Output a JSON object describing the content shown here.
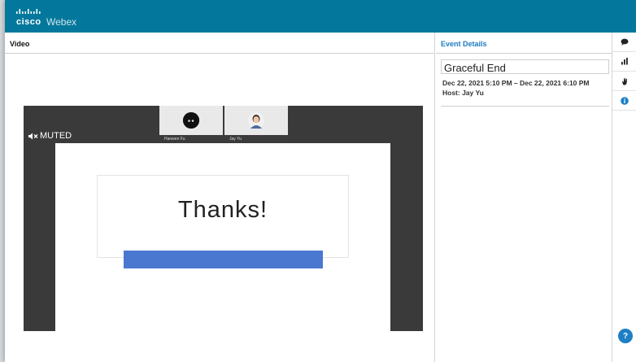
{
  "app": {
    "brand": "cisco",
    "product": "Webex",
    "brand_color": "#04789c"
  },
  "video_panel": {
    "title": "Video",
    "muted_label": "MUTED",
    "participants": [
      {
        "name": "Hanwen Fu",
        "icon": "avatar-dark-icon"
      },
      {
        "name": "Jay Yu",
        "icon": "avatar-photo-icon"
      }
    ],
    "slide": {
      "title": "Thanks!",
      "bar_color": "#4a78d0"
    }
  },
  "details_panel": {
    "title": "Event Details",
    "event_title": "Graceful End",
    "dates": "Dec 22, 2021 5:10 PM – Dec 22, 2021 6:10 PM",
    "host": "Host: Jay Yu"
  },
  "rail": {
    "items": [
      {
        "icon": "chat-icon"
      },
      {
        "icon": "polling-icon"
      },
      {
        "icon": "raise-hand-icon"
      },
      {
        "icon": "info-icon",
        "accent": "#1d7fc4"
      }
    ],
    "help_label": "?"
  }
}
